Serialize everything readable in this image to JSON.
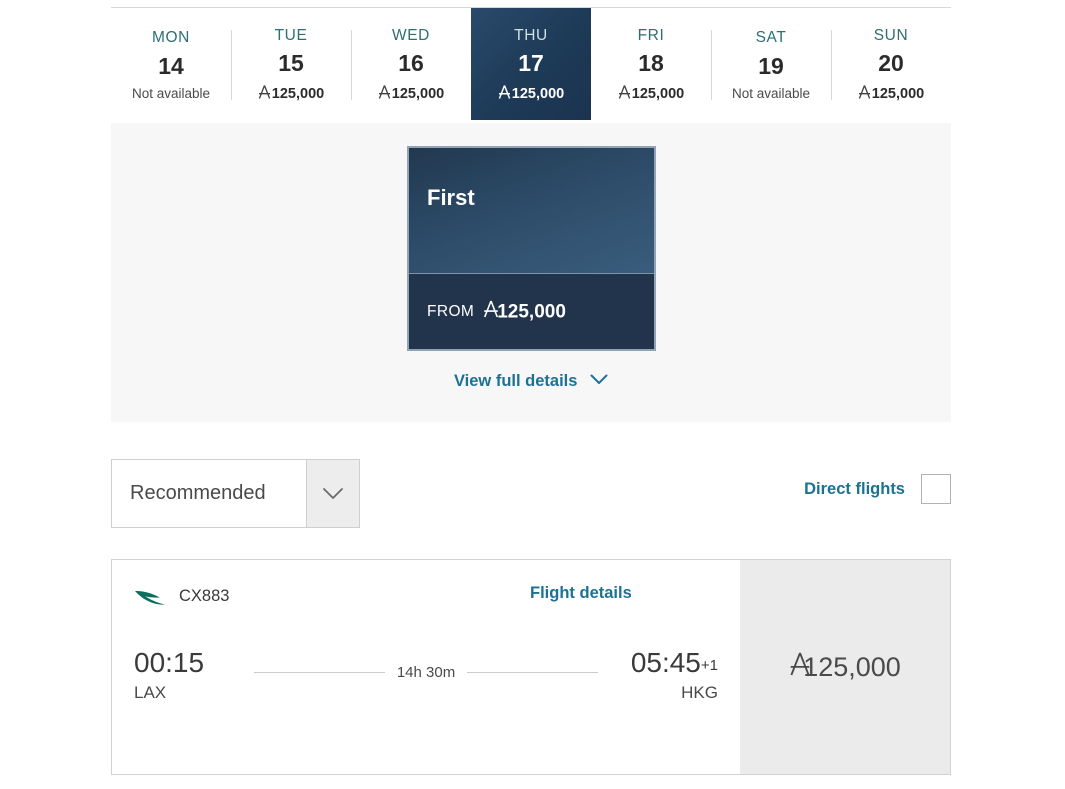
{
  "currency_symbol_name": "asia-miles-icon",
  "colors": {
    "accent_teal": "#1c7293",
    "dow_teal": "#2d6e73",
    "selected_navy": "#1d3a57",
    "panel_gray": "#f7f7f7",
    "price_panel_gray": "#ebebeb",
    "text_dark": "#3a3a3a"
  },
  "date_strip": {
    "prev_label": "‹",
    "next_label": "›",
    "days": [
      {
        "dow": "MON",
        "day": "14",
        "price": "Not available",
        "available": false,
        "selected": false
      },
      {
        "dow": "TUE",
        "day": "15",
        "price": "125,000",
        "available": true,
        "selected": false
      },
      {
        "dow": "WED",
        "day": "16",
        "price": "125,000",
        "available": true,
        "selected": false
      },
      {
        "dow": "THU",
        "day": "17",
        "price": "125,000",
        "available": true,
        "selected": true
      },
      {
        "dow": "FRI",
        "day": "18",
        "price": "125,000",
        "available": true,
        "selected": false
      },
      {
        "dow": "SAT",
        "day": "19",
        "price": "Not available",
        "available": false,
        "selected": false
      },
      {
        "dow": "SUN",
        "day": "20",
        "price": "125,000",
        "available": true,
        "selected": false
      }
    ]
  },
  "cabin": {
    "name": "First",
    "from_label": "FROM",
    "price": "125,000",
    "view_details_label": "View full details"
  },
  "filters": {
    "sort_value": "Recommended",
    "direct_flights_label": "Direct flights",
    "direct_flights_checked": false
  },
  "flight": {
    "carrier_icon": "cathay-brushwing-icon",
    "flight_number": "CX883",
    "details_link": "Flight details",
    "depart_time": "00:15",
    "depart_airport": "LAX",
    "duration": "14h 30m",
    "arrive_time": "05:45",
    "arrive_day_offset": "+1",
    "arrive_airport": "HKG",
    "price": "125,000"
  }
}
